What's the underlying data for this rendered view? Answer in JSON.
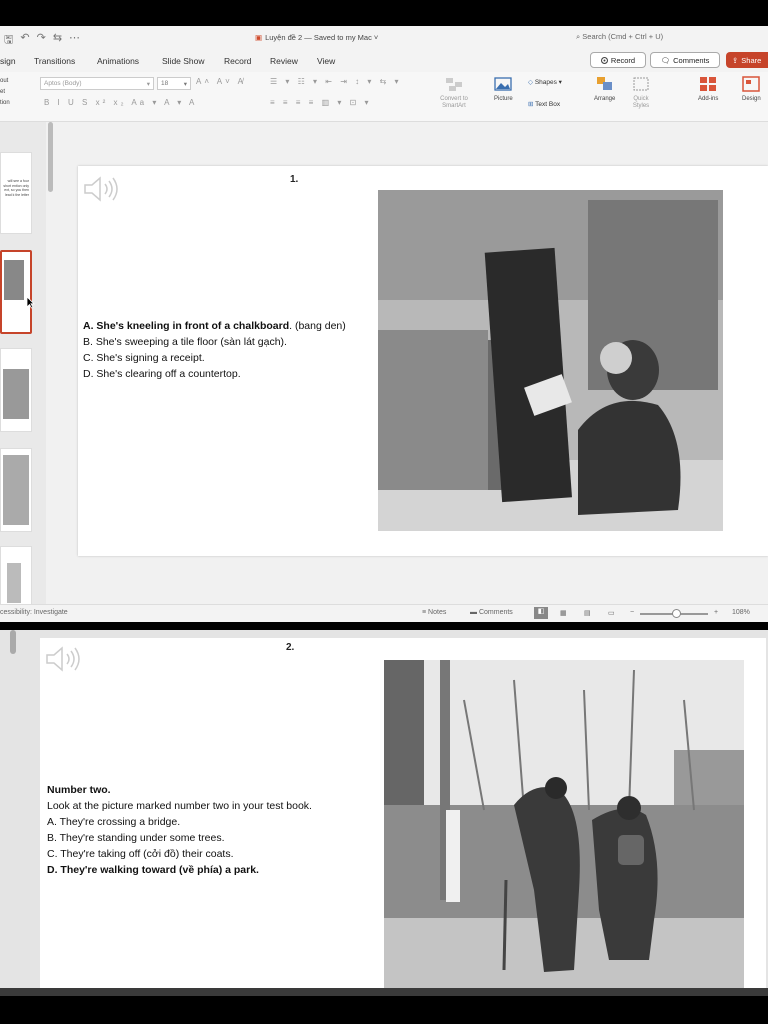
{
  "app": {
    "doc_title": "Luyện đề 2 — Saved to my Mac",
    "search_placeholder": "Search (Cmd + Ctrl + U)"
  },
  "tabs": [
    "sign",
    "Transitions",
    "Animations",
    "Slide Show",
    "Record",
    "Review",
    "View"
  ],
  "actions": {
    "record": "Record",
    "comments": "Comments",
    "share": "Share"
  },
  "ribbon": {
    "left_labels": [
      "out",
      "et",
      "tion"
    ],
    "font_name": "Aptos (Body)",
    "font_size": "18",
    "convert_smartart": "Convert to SmartArt",
    "picture": "Picture",
    "shapes": "Shapes",
    "textbox": "Text Box",
    "arrange": "Arrange",
    "quick_styles": "Quick Styles",
    "addins": "Add-ins",
    "designer": "Design"
  },
  "status": {
    "accessibility": "cessibility: Investigate",
    "notes": "Notes",
    "comments": "Comments",
    "zoom": "108%"
  },
  "slide1": {
    "number": "1.",
    "options": [
      {
        "text": "A. She's kneeling in front of a chalkboard",
        "suffix": ". (bang den)"
      },
      {
        "text": "B. She's sweeping a tile floor (sàn lát gạch)."
      },
      {
        "text": "C. She's signing a receipt."
      },
      {
        "text": "D. She's clearing off a countertop."
      }
    ]
  },
  "slide2": {
    "number": "2.",
    "heading": "Number two.",
    "instruction": "Look at the picture marked number two in your test book.",
    "options": [
      "A. They're crossing a bridge.",
      "B. They're standing under some trees.",
      "C. They're taking off (cởi đồ) their coats.",
      "D. They're walking toward (về phía) a park."
    ]
  },
  "thumb_text": "will see a four short ention only ext, so you then lead k the letter"
}
